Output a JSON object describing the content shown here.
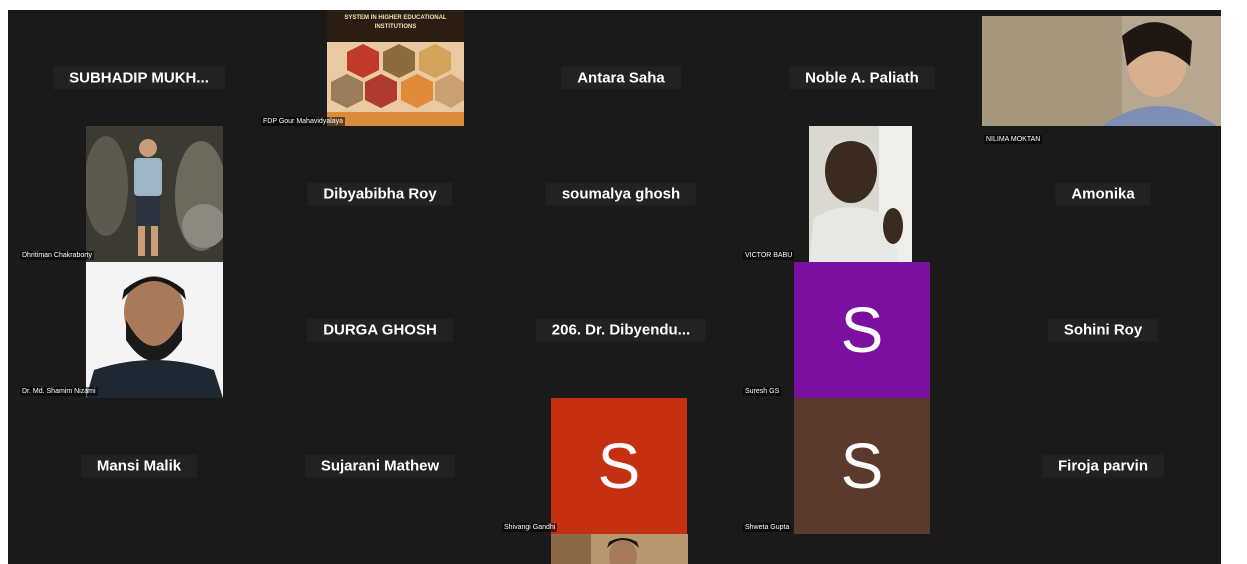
{
  "participants": [
    {
      "name": "SUBHADIP  MUKH...",
      "kind": "name"
    },
    {
      "name": "FDP Gour Mahavidyalaya",
      "kind": "video",
      "slide_title": "SYSTEM IN HIGHER EDUCATIONAL INSTITUTIONS"
    },
    {
      "name": "Antara Saha",
      "kind": "name"
    },
    {
      "name": "Noble A. Paliath",
      "kind": "name"
    },
    {
      "name": "NILIMA MOKTAN",
      "kind": "video"
    },
    {
      "name": "Dhritiman Chakraborty",
      "kind": "video"
    },
    {
      "name": "Dibyabibha Roy",
      "kind": "name"
    },
    {
      "name": "soumalya ghosh",
      "kind": "name"
    },
    {
      "name": "VICTOR BABU",
      "kind": "video"
    },
    {
      "name": "Amonika",
      "kind": "name"
    },
    {
      "name": "Dr. Md. Shamim Nizami",
      "kind": "video"
    },
    {
      "name": "DURGA GHOSH",
      "kind": "name"
    },
    {
      "name": "206. Dr. Dibyendu...",
      "kind": "name"
    },
    {
      "name": "Suresh GS",
      "kind": "avatar",
      "initial": "S",
      "color": "#7a0fa0"
    },
    {
      "name": "Sohini Roy",
      "kind": "name"
    },
    {
      "name": "Mansi Malik",
      "kind": "name"
    },
    {
      "name": "Sujarani Mathew",
      "kind": "name"
    },
    {
      "name": "Shivangi Gandhi",
      "kind": "avatar",
      "initial": "S",
      "color": "#c43010"
    },
    {
      "name": "Shweta Gupta",
      "kind": "avatar",
      "initial": "S",
      "color": "#5b3a2e"
    },
    {
      "name": "Firoja parvin",
      "kind": "name"
    }
  ]
}
